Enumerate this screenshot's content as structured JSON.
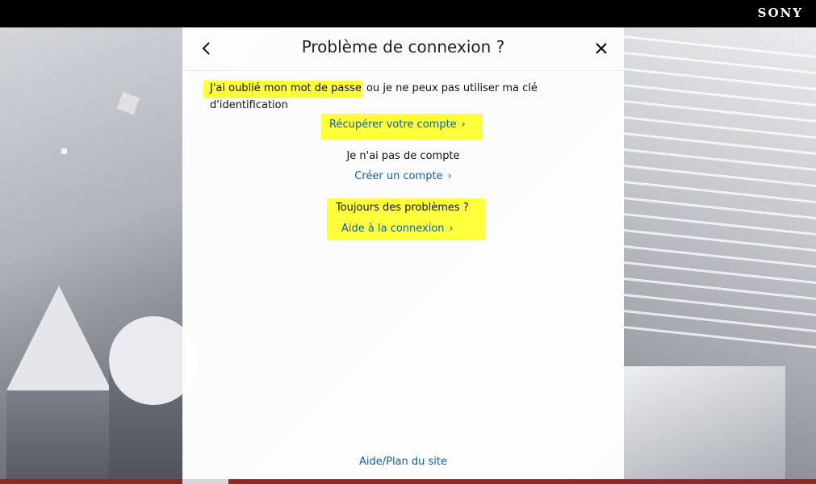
{
  "brand": {
    "logo_text": "SONY"
  },
  "dialog": {
    "title": "Problème de connexion ?",
    "back_icon": "chevron-left-icon",
    "close_icon": "close-icon",
    "forgot_highlight": "J'ai oublié mon mot de passe",
    "forgot_rest": " ou je ne peux pas utiliser ma clé d'identification",
    "recover_link": "Récupérer votre compte",
    "no_account_text": "Je n'ai pas de compte",
    "create_link": "Créer un compte",
    "still_problems_text": "Toujours des problèmes ?",
    "help_link": "Aide à la connexion",
    "sitemap_link": "Aide/Plan du site",
    "link_chevron": "›"
  },
  "colors": {
    "highlight": "#ffff3b",
    "link": "#0f5fa8",
    "topbar": "#000000"
  }
}
